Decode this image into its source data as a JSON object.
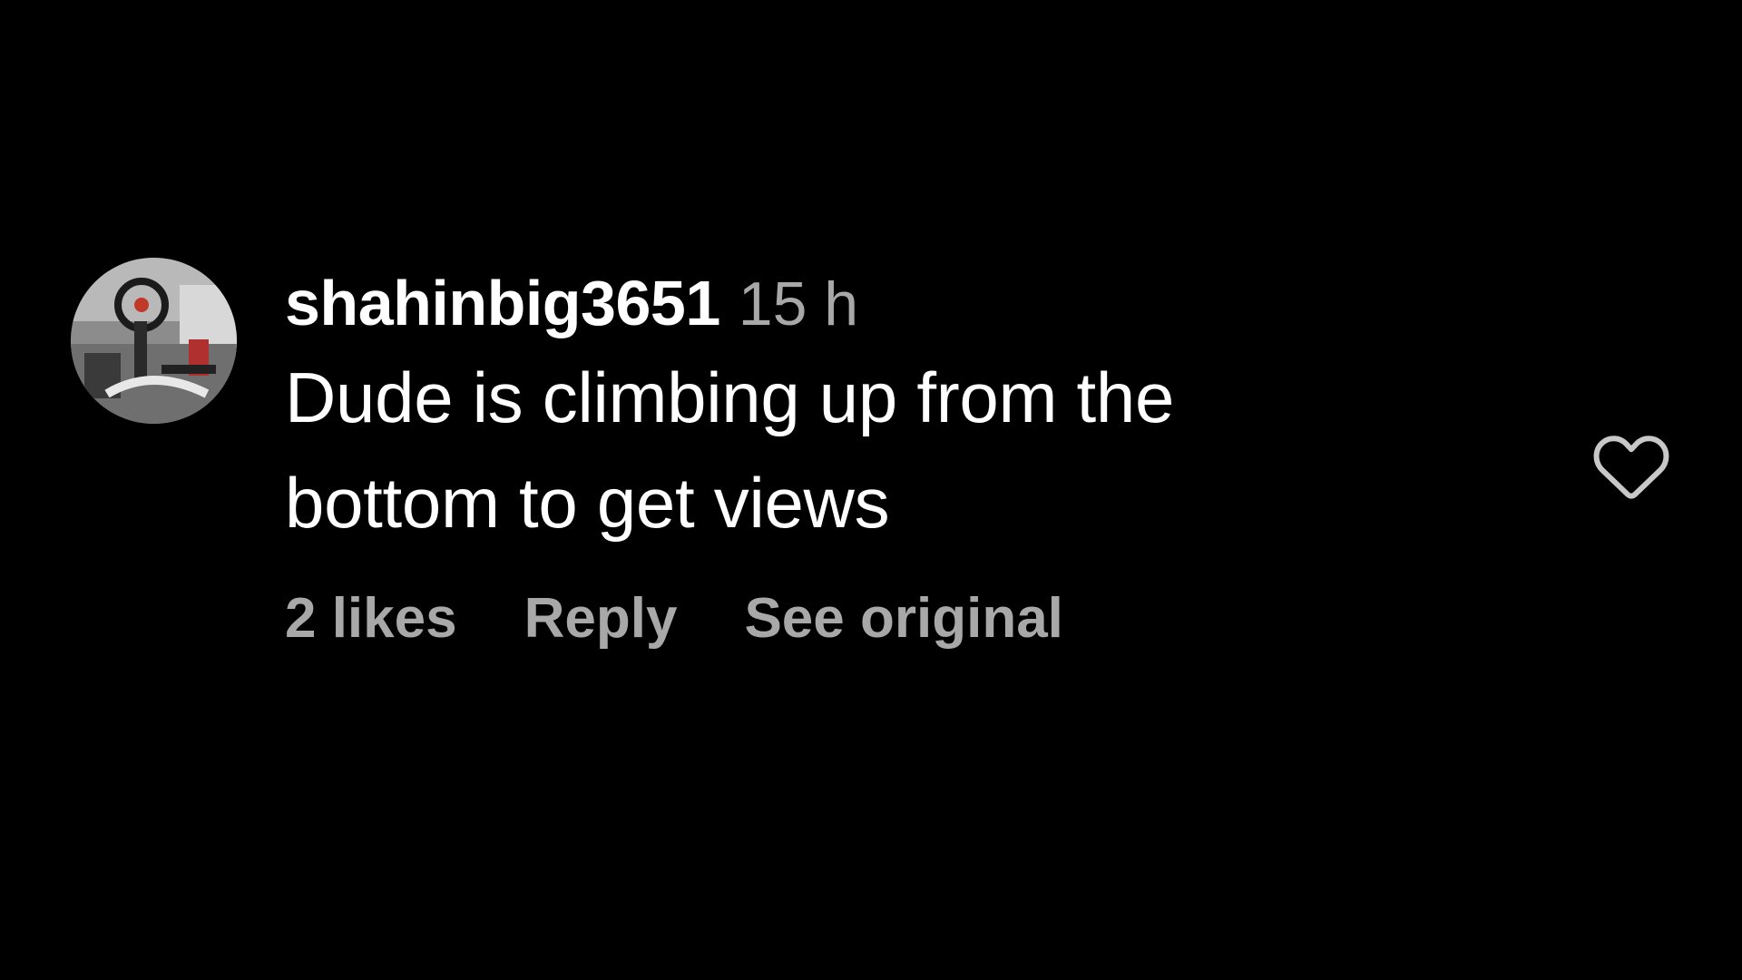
{
  "comment": {
    "username": "shahinbig3651",
    "timestamp": "15 h",
    "text": "Dude is climbing up from the bottom to get views",
    "likes_label": "2 likes",
    "reply_label": "Reply",
    "see_original_label": "See original",
    "avatar_icon": "profile-photo-racing-wheel",
    "like_icon": "heart-outline-icon"
  },
  "colors": {
    "background": "#000000",
    "primary_text": "#ffffff",
    "secondary_text": "#a8a8a8",
    "icon": "#c8c8c8"
  }
}
